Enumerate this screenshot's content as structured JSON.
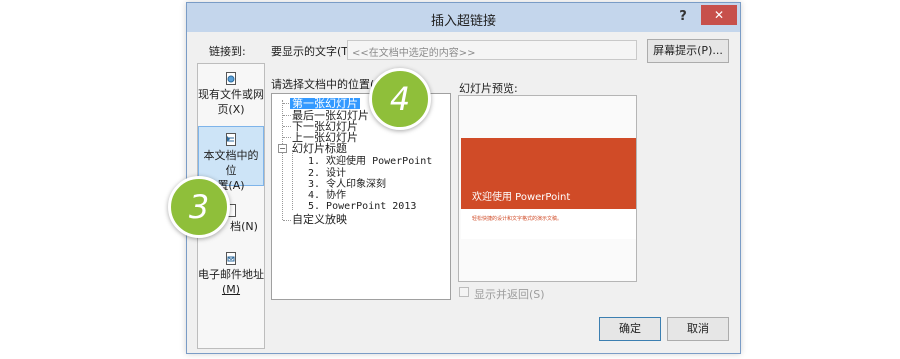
{
  "dialog": {
    "title": "插入超链接",
    "help_label": "?",
    "close_label": "✕"
  },
  "link_to": {
    "label": "链接到:"
  },
  "text_to_display": {
    "label": "要显示的文字(T):",
    "value": "<<在文档中选定的内容>>"
  },
  "screentip_button": {
    "label": "屏幕提示(P)..."
  },
  "nav": {
    "items": [
      {
        "label_line1": "现有文件或网",
        "label_line2": "页(X)",
        "icon": "globe-file-icon"
      },
      {
        "label_line1": "本文档中的位",
        "label_line2": "置(A)",
        "icon": "document-place-icon"
      },
      {
        "label_line1": "新建文档(N)",
        "label_line2": "",
        "icon": "new-document-icon"
      },
      {
        "label_line1": "电子邮件地址",
        "label_line2": "(M)",
        "icon": "email-icon"
      }
    ],
    "selected_index": 1,
    "partial_visible_label": "档(N)"
  },
  "place_tree": {
    "label": "请选择文档中的位置(C):",
    "items": [
      {
        "text": "第一张幻灯片",
        "selected": true
      },
      {
        "text": "最后一张幻灯片"
      },
      {
        "text": "下一张幻灯片"
      },
      {
        "text": "上一张幻灯片"
      },
      {
        "text": "幻灯片标题",
        "expandable": true,
        "toggle": "−"
      },
      {
        "text": "1. 欢迎使用 PowerPoint",
        "child": true
      },
      {
        "text": "2. 设计",
        "child": true
      },
      {
        "text": "3. 令人印象深刻",
        "child": true
      },
      {
        "text": "4. 协作",
        "child": true
      },
      {
        "text": "5. PowerPoint 2013",
        "child": true
      },
      {
        "text": "自定义放映"
      }
    ]
  },
  "preview": {
    "label": "幻灯片预览:",
    "slide_title": "欢迎使用 PowerPoint",
    "slide_subtitle": "轻松快捷的设计和文字格式的演示文稿。"
  },
  "show_and_return": {
    "label": "显示并返回(S)",
    "checked": false,
    "enabled": false
  },
  "buttons": {
    "ok": "确定",
    "cancel": "取消"
  },
  "steps": {
    "step3": "3",
    "step4": "4"
  },
  "colors": {
    "accent": "#d04b27",
    "step": "#8fbf3a",
    "selection": "#3399ff"
  }
}
